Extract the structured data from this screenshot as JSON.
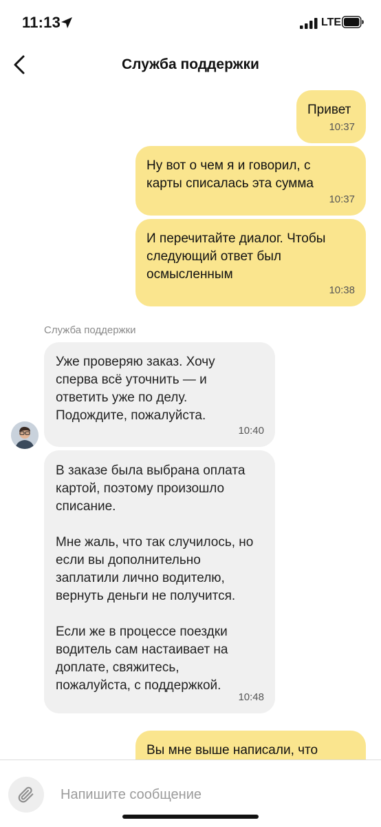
{
  "status_bar": {
    "time": "11:13",
    "network": "LTE"
  },
  "header": {
    "title": "Служба поддержки"
  },
  "messages": [
    {
      "direction": "out",
      "text": "Привет",
      "time": "10:37"
    },
    {
      "direction": "out",
      "text": "Ну вот о чем я и говорил, с\nкарты списалась эта сумма",
      "time": "10:37"
    },
    {
      "direction": "out",
      "text": "И перечитайте диалог. Чтобы\nследующий ответ был\nосмысленным",
      "time": "10:38"
    },
    {
      "direction": "in",
      "text": "Уже проверяю заказ. Хочу\nсперва всё уточнить — и\nответить уже по делу.\nПодождите, пожалуйста.",
      "time": "10:40"
    },
    {
      "direction": "in",
      "text": "В заказе была выбрана оплата\nкартой, поэтому произошло\nсписание.\n\nМне жаль, что так случилось, но\nесли вы дополнительно\nзаплатили лично водителю,\nвернуть деньги не получится.\n\nЕсли же в процессе поездки\nводитель сам настаивает на\nдоплате, свяжитесь,\nпожалуйста, с поддержкой.",
      "time": "10:48"
    },
    {
      "direction": "out",
      "text": "Вы мне выше написали, что",
      "time": ""
    }
  ],
  "support_sender": "Служба поддержки",
  "composer": {
    "placeholder": "Напишите сообщение"
  },
  "colors": {
    "outgoing_bubble": "#fae58e",
    "incoming_bubble": "#f0f0f0"
  },
  "icons": [
    "location-arrow-icon",
    "signal-icon",
    "battery-icon",
    "back-arrow-icon",
    "paperclip-icon"
  ]
}
